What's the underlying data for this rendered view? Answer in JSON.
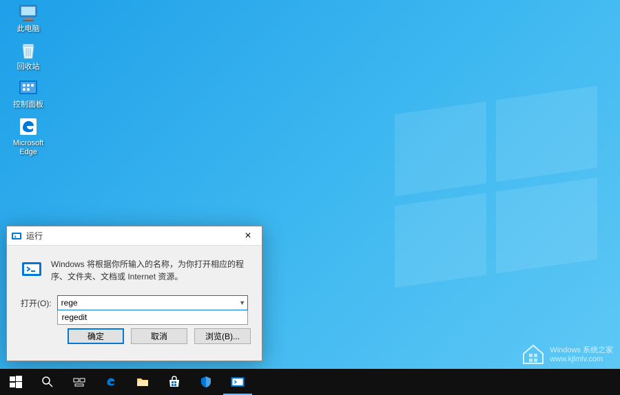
{
  "desktop": {
    "icons": [
      {
        "name": "此电脑",
        "type": "pc"
      },
      {
        "name": "回收站",
        "type": "bin"
      },
      {
        "name": "控制面板",
        "type": "control"
      },
      {
        "name": "Microsoft Edge",
        "type": "edge"
      }
    ]
  },
  "run_dialog": {
    "title": "运行",
    "description": "Windows 将根据你所输入的名称，为你打开相应的程序、文件夹、文档或 Internet 资源。",
    "input_label": "打开(O):",
    "input_value": "rege",
    "autocomplete_suggestion": "regedit",
    "buttons": {
      "ok": "确定",
      "cancel": "取消",
      "browse": "浏览(B)..."
    },
    "close_label": "×"
  },
  "watermark": {
    "line1": "Windows 系统之家",
    "line2": "www.kjlmlv.com"
  }
}
